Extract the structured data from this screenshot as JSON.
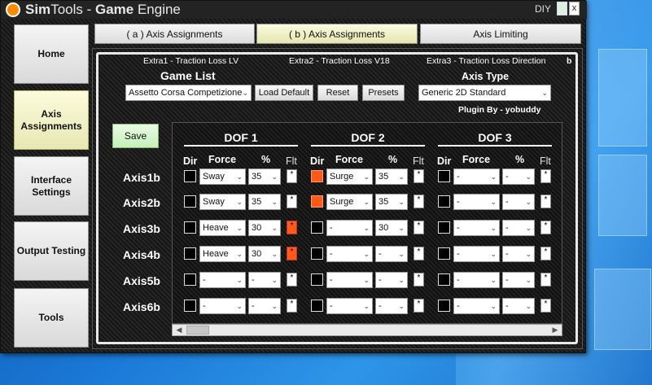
{
  "window": {
    "title_a": "Sim",
    "title_b": "Tools - ",
    "title_c": "Game",
    "title_d": " Engine",
    "diy": "DIY",
    "close": "x"
  },
  "sidebar": [
    "Home",
    "Axis Assignments",
    "Interface Settings",
    "Output Testing",
    "Tools"
  ],
  "tabs": [
    "( a ) Axis Assignments",
    "( b ) Axis Assignments",
    "Axis Limiting"
  ],
  "extras": [
    "Extra1 - Traction Loss LV",
    "Extra2 - Traction Loss V18",
    "Extra3 - Traction Loss Direction",
    "b"
  ],
  "game_list": {
    "label": "Game List",
    "value": "Assetto Corsa Competizione"
  },
  "buttons": {
    "load_default": "Load Default",
    "reset": "Reset",
    "presets": "Presets",
    "save": "Save"
  },
  "axis_type": {
    "label": "Axis Type",
    "value": "Generic 2D Standard"
  },
  "plugin": "Plugin By - yobuddy",
  "dof_headers": [
    "DOF 1",
    "DOF 2",
    "DOF 3"
  ],
  "col_headers": {
    "dir": "Dir",
    "force": "Force",
    "pct": "%",
    "flt": "Flt"
  },
  "flt_mark": "*",
  "dash": "-",
  "rows": [
    {
      "axis": "Axis1b",
      "dof": [
        {
          "dir": false,
          "force": "Sway",
          "pct": "35",
          "flt": false
        },
        {
          "dir": true,
          "force": "Surge",
          "pct": "35",
          "flt": false
        },
        {
          "dir": false,
          "force": "-",
          "pct": "-",
          "flt": false
        }
      ]
    },
    {
      "axis": "Axis2b",
      "dof": [
        {
          "dir": false,
          "force": "Sway",
          "pct": "35",
          "flt": false
        },
        {
          "dir": true,
          "force": "Surge",
          "pct": "35",
          "flt": false
        },
        {
          "dir": false,
          "force": "-",
          "pct": "-",
          "flt": false
        }
      ]
    },
    {
      "axis": "Axis3b",
      "dof": [
        {
          "dir": false,
          "force": "Heave",
          "pct": "30",
          "flt": true
        },
        {
          "dir": false,
          "force": "-",
          "pct": "30",
          "flt": false
        },
        {
          "dir": false,
          "force": "-",
          "pct": "-",
          "flt": false
        }
      ]
    },
    {
      "axis": "Axis4b",
      "dof": [
        {
          "dir": false,
          "force": "Heave",
          "pct": "30",
          "flt": true
        },
        {
          "dir": false,
          "force": "-",
          "pct": "-",
          "flt": false
        },
        {
          "dir": false,
          "force": "-",
          "pct": "-",
          "flt": false
        }
      ]
    },
    {
      "axis": "Axis5b",
      "dof": [
        {
          "dir": false,
          "force": "-",
          "pct": "-",
          "flt": false
        },
        {
          "dir": false,
          "force": "-",
          "pct": "-",
          "flt": false
        },
        {
          "dir": false,
          "force": "-",
          "pct": "-",
          "flt": false
        }
      ]
    },
    {
      "axis": "Axis6b",
      "dof": [
        {
          "dir": false,
          "force": "-",
          "pct": "-",
          "flt": false
        },
        {
          "dir": false,
          "force": "-",
          "pct": "-",
          "flt": false
        },
        {
          "dir": false,
          "force": "-",
          "pct": "-",
          "flt": false
        }
      ]
    }
  ],
  "colors": {
    "accent_on": "#ff5a1a",
    "active_tab": "#f0f0c8",
    "save_green": "#d6f5cc"
  }
}
